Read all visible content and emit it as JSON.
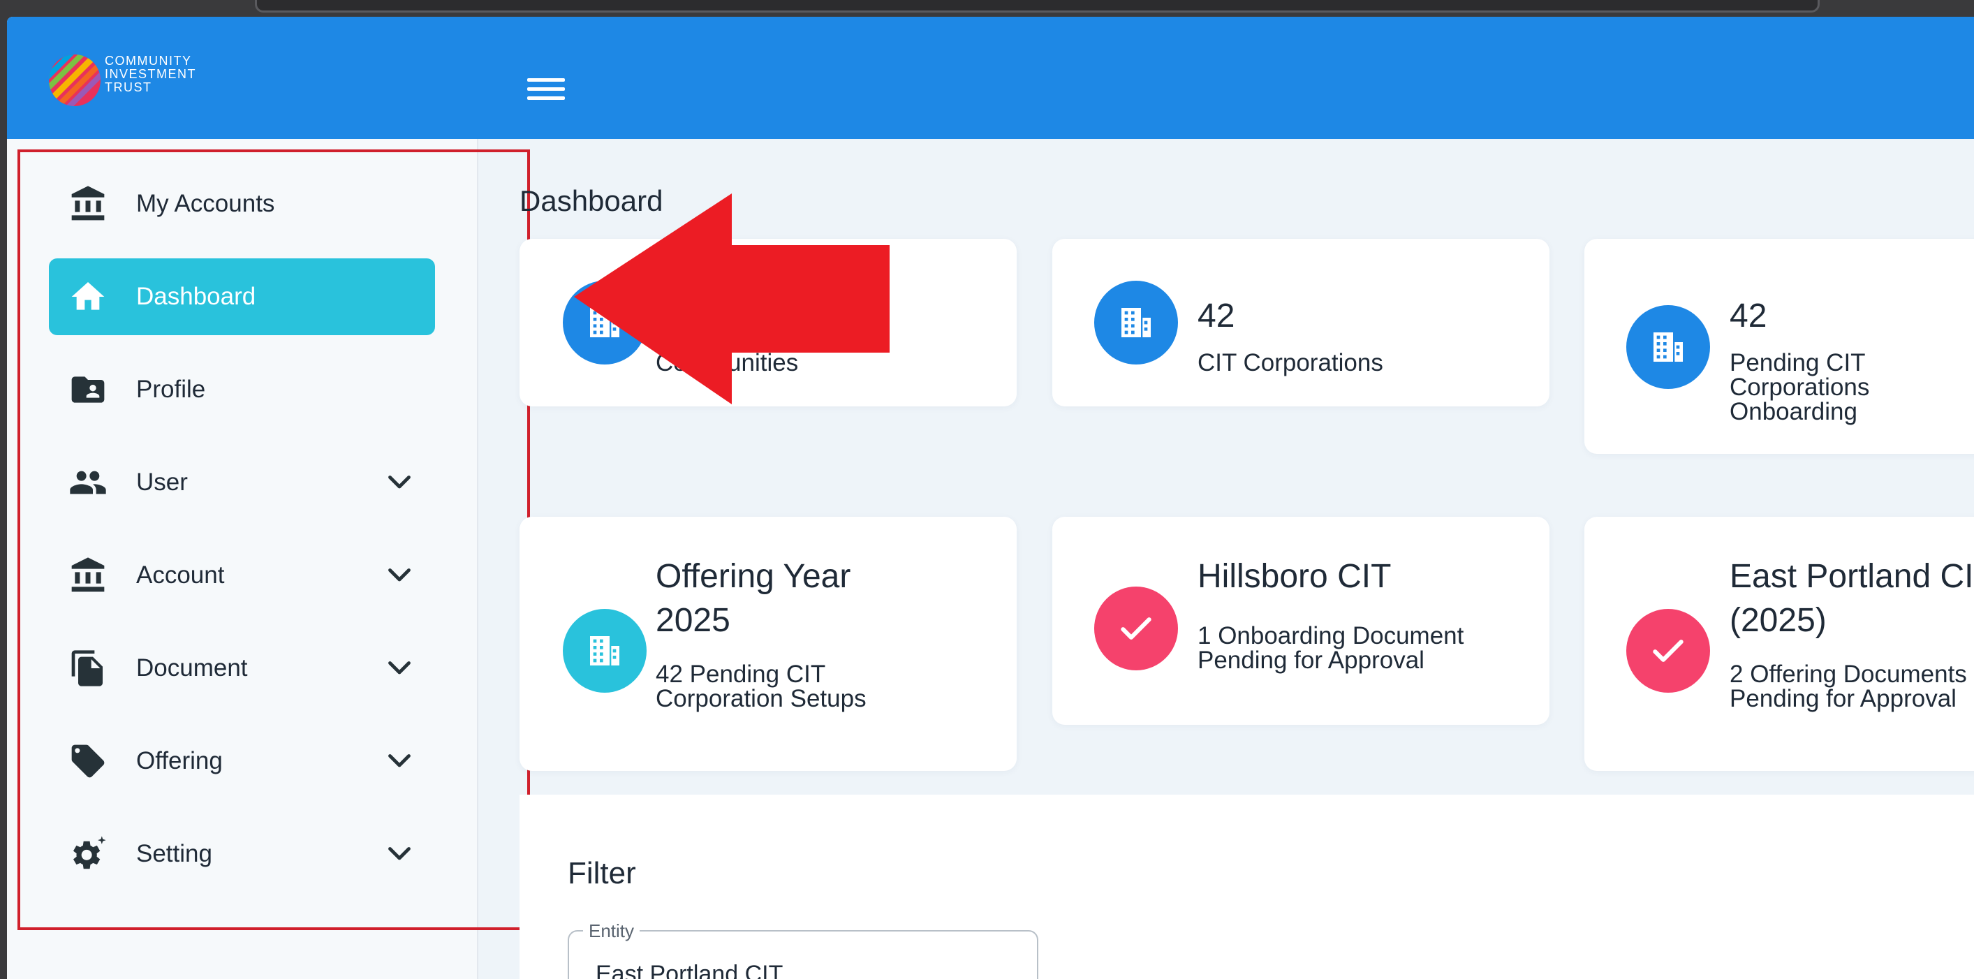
{
  "logo": {
    "lines": [
      "COMMUNITY",
      "INVESTMENT",
      "TRUST"
    ]
  },
  "sidebar": {
    "items": [
      {
        "label": "My Accounts",
        "icon": "bank-icon",
        "expandable": false,
        "active": false
      },
      {
        "label": "Dashboard",
        "icon": "home-icon",
        "expandable": false,
        "active": true
      },
      {
        "label": "Profile",
        "icon": "profile-folder-icon",
        "expandable": false,
        "active": false
      },
      {
        "label": "User",
        "icon": "users-icon",
        "expandable": true,
        "active": false
      },
      {
        "label": "Account",
        "icon": "bank-icon",
        "expandable": true,
        "active": false
      },
      {
        "label": "Document",
        "icon": "document-icon",
        "expandable": true,
        "active": false
      },
      {
        "label": "Offering",
        "icon": "tag-icon",
        "expandable": true,
        "active": false
      },
      {
        "label": "Setting",
        "icon": "settings-gear-icon",
        "expandable": true,
        "active": false
      }
    ]
  },
  "main": {
    "title": "Dashboard",
    "cards": [
      {
        "value": "",
        "text": "Communities",
        "icon": "building-icon",
        "color": "#1e88e5"
      },
      {
        "value": "42",
        "text": "CIT Corporations",
        "icon": "building-icon",
        "color": "#1e88e5"
      },
      {
        "value": "42",
        "text_lines": [
          "Pending CIT",
          "Corporations",
          "Onboarding"
        ],
        "icon": "building-icon",
        "color": "#1e88e5"
      },
      {
        "title_lines": [
          "Offering Year",
          "2025"
        ],
        "text_lines": [
          "42 Pending CIT",
          "Corporation Setups"
        ],
        "icon": "building-icon",
        "color": "#29c2dc"
      },
      {
        "title": "Hillsboro CIT",
        "text_lines": [
          "1 Onboarding Document",
          "Pending for Approval"
        ],
        "icon": "check-icon",
        "color": "#f5426c"
      },
      {
        "title_lines": [
          "East Portland CIT",
          "(2025)"
        ],
        "text_lines": [
          "2 Offering Documents",
          "Pending for Approval"
        ],
        "icon": "check-icon",
        "color": "#f5426c"
      }
    ]
  },
  "filter": {
    "title": "Filter",
    "entity": {
      "label": "Entity",
      "value": "East Portland CIT"
    }
  },
  "colors": {
    "topbar": "#1e88e5",
    "active_nav": "#29c2dc",
    "highlight_box": "#d0202c",
    "arrow": "#ec1c24"
  }
}
